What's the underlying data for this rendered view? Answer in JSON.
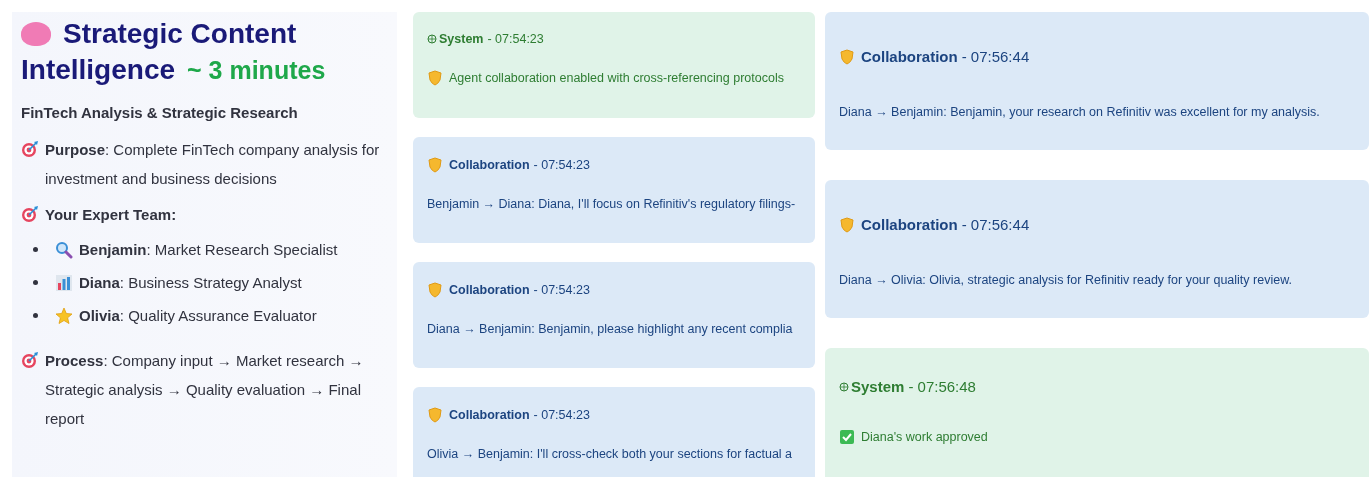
{
  "intro": {
    "title_lines": [
      "Strategic Content",
      "Intelligence"
    ],
    "duration": "~ 3 minutes",
    "subtitle": "FinTech Analysis & Strategic Research",
    "purpose": "**Purpose**: Complete FinTech company analysis for investment and business decisions",
    "team_heading": "Your Expert Team:",
    "team": [
      {
        "kind": "search",
        "text": "**Benjamin**: Market Research Specialist"
      },
      {
        "kind": "chart",
        "text": "**Diana**: Business Strategy Analyst"
      },
      {
        "kind": "star",
        "text": "**Olivia**: Quality Assurance Evaluator"
      }
    ],
    "process": "**Process**: Company input → Market research → Strategic analysis → Quality evaluation → Final report"
  },
  "feed_columns": [
    {
      "messages": [
        {
          "kind": "system",
          "sender": "System",
          "time": "- 07:54:23",
          "body": {
            "kind": "note",
            "text": "Agent collaboration enabled with cross-referencing protocols"
          }
        },
        {
          "kind": "collaboration",
          "sender": "Collaboration",
          "time": "- 07:54:23",
          "body": {
            "kind": "plain",
            "text": "Benjamin → Diana: Diana, I'll focus on Refinitiv's regulatory filings-"
          }
        },
        {
          "kind": "collaboration",
          "sender": "Collaboration",
          "time": "- 07:54:23",
          "body": {
            "kind": "plain",
            "text": "Diana → Benjamin: Benjamin, please highlight any recent complia"
          }
        },
        {
          "kind": "collaboration",
          "sender": "Collaboration",
          "time": "- 07:54:23",
          "body": {
            "kind": "plain",
            "text": "Olivia → Benjamin: I'll cross-check both your sections for factual a"
          }
        }
      ]
    },
    {
      "messages": [
        {
          "kind": "collaboration",
          "sender": "Collaboration",
          "time": "- 07:56:44",
          "body": {
            "kind": "plain",
            "text": "Diana → Benjamin: Benjamin, your research on Refinitiv was excellent for my analysis."
          }
        },
        {
          "kind": "collaboration",
          "sender": "Collaboration",
          "time": "- 07:56:44",
          "body": {
            "kind": "plain",
            "text": "Diana → Olivia: Olivia, strategic analysis for Refinitiv ready for your quality review."
          }
        },
        {
          "kind": "system",
          "sender": "System",
          "time": "- 07:56:48",
          "body": {
            "kind": "approval",
            "text": "Diana's work approved"
          }
        }
      ]
    }
  ]
}
